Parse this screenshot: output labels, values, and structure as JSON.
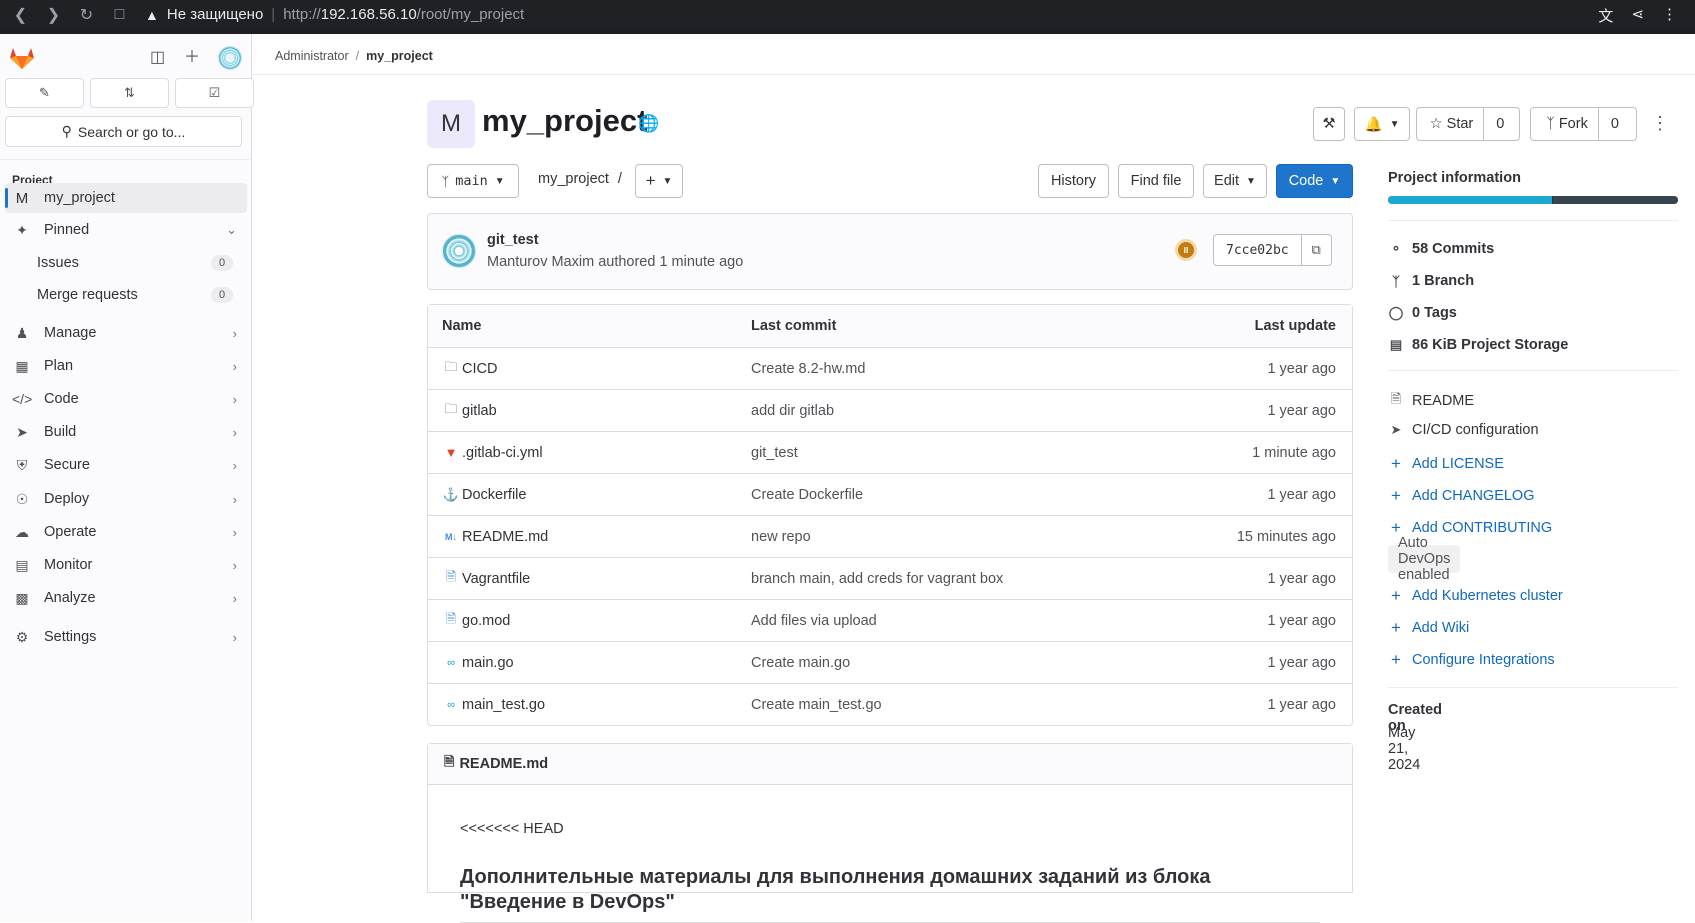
{
  "browser": {
    "insecure_label": "Не защищено",
    "url_prefix": "http://",
    "url_host": "192.168.56.10",
    "url_path": "/root/my_project"
  },
  "sidebar": {
    "search_label": "Search or go to...",
    "section_heading": "Project",
    "project_item": {
      "initial": "M",
      "label": "my_project"
    },
    "pinned_label": "Pinned",
    "pinned_items": [
      {
        "label": "Issues",
        "count": "0"
      },
      {
        "label": "Merge requests",
        "count": "0"
      }
    ],
    "nav_items": [
      {
        "label": "Manage",
        "icon": "users-icon"
      },
      {
        "label": "Plan",
        "icon": "calendar-icon"
      },
      {
        "label": "Code",
        "icon": "code-icon"
      },
      {
        "label": "Build",
        "icon": "rocket-icon"
      },
      {
        "label": "Secure",
        "icon": "shield-icon"
      },
      {
        "label": "Deploy",
        "icon": "deploy-icon"
      },
      {
        "label": "Operate",
        "icon": "cloud-icon"
      },
      {
        "label": "Monitor",
        "icon": "monitor-icon"
      },
      {
        "label": "Analyze",
        "icon": "chart-icon"
      },
      {
        "label": "Settings",
        "icon": "gear-icon"
      }
    ]
  },
  "breadcrumb": {
    "parent": "Administrator",
    "current": "my_project"
  },
  "project": {
    "avatar_initial": "M",
    "title": "my_project",
    "star_label": "Star",
    "star_count": "0",
    "fork_label": "Fork",
    "fork_count": "0"
  },
  "repo_toolbar": {
    "branch": "main",
    "path": "my_project",
    "path_sep": "/",
    "history_label": "History",
    "find_file_label": "Find file",
    "edit_label": "Edit",
    "code_label": "Code"
  },
  "last_commit": {
    "title": "git_test",
    "meta": "Manturov Maxim authored 1 minute ago",
    "sha": "7cce02bc",
    "status_color": "#c17d10"
  },
  "files": {
    "headers": {
      "name": "Name",
      "last_commit": "Last commit",
      "last_update": "Last update"
    },
    "rows": [
      {
        "name": "CICD",
        "icon": "folder-icon",
        "commit": "Create 8.2-hw.md",
        "updated": "1 year ago"
      },
      {
        "name": "gitlab",
        "icon": "folder-icon",
        "commit": "add dir gitlab",
        "updated": "1 year ago"
      },
      {
        "name": ".gitlab-ci.yml",
        "icon": "gitlab-file-icon",
        "commit": "git_test",
        "updated": "1 minute ago"
      },
      {
        "name": "Dockerfile",
        "icon": "docker-icon",
        "commit": "Create Dockerfile",
        "updated": "1 year ago"
      },
      {
        "name": "README.md",
        "icon": "markdown-icon",
        "commit": "new repo",
        "updated": "15 minutes ago"
      },
      {
        "name": "Vagrantfile",
        "icon": "file-icon",
        "commit": "branch main, add creds for vagrant box",
        "updated": "1 year ago"
      },
      {
        "name": "go.mod",
        "icon": "file-icon",
        "commit": "Add files via upload",
        "updated": "1 year ago"
      },
      {
        "name": "main.go",
        "icon": "go-icon",
        "commit": "Create main.go",
        "updated": "1 year ago"
      },
      {
        "name": "main_test.go",
        "icon": "go-icon",
        "commit": "Create main_test.go",
        "updated": "1 year ago"
      }
    ]
  },
  "readme": {
    "filename": "README.md",
    "line1": "<<<<<<< HEAD",
    "heading": "Дополнительные материалы для выполнения домашних заданий из блока \"Введение в DevOps\""
  },
  "project_info": {
    "title": "Project information",
    "language_bar": [
      {
        "share": 0.567,
        "color": "#1aaad2"
      },
      {
        "share": 0.433,
        "color": "#36454f"
      }
    ],
    "stats": [
      {
        "value": "58",
        "label": "Commits",
        "icon": "commit-icon"
      },
      {
        "value": "1",
        "label": "Branch",
        "icon": "branch-icon"
      },
      {
        "value": "0",
        "label": "Tags",
        "icon": "tag-icon"
      },
      {
        "value": "86 KiB",
        "label": "Project Storage",
        "icon": "storage-icon"
      }
    ],
    "links": [
      {
        "label": "README",
        "icon": "doc-icon",
        "kind": "plain"
      },
      {
        "label": "CI/CD configuration",
        "icon": "rocket-icon",
        "kind": "plain"
      },
      {
        "label": "Add LICENSE",
        "icon": "plus-icon",
        "kind": "link"
      },
      {
        "label": "Add CHANGELOG",
        "icon": "plus-icon",
        "kind": "link"
      },
      {
        "label": "Add CONTRIBUTING",
        "icon": "plus-icon",
        "kind": "link"
      }
    ],
    "auto_devops": "Auto DevOps enabled",
    "links2": [
      {
        "label": "Add Kubernetes cluster",
        "icon": "plus-icon"
      },
      {
        "label": "Add Wiki",
        "icon": "plus-icon"
      },
      {
        "label": "Configure Integrations",
        "icon": "plus-icon"
      }
    ],
    "created_label": "Created on",
    "created_value": "May 21, 2024"
  }
}
